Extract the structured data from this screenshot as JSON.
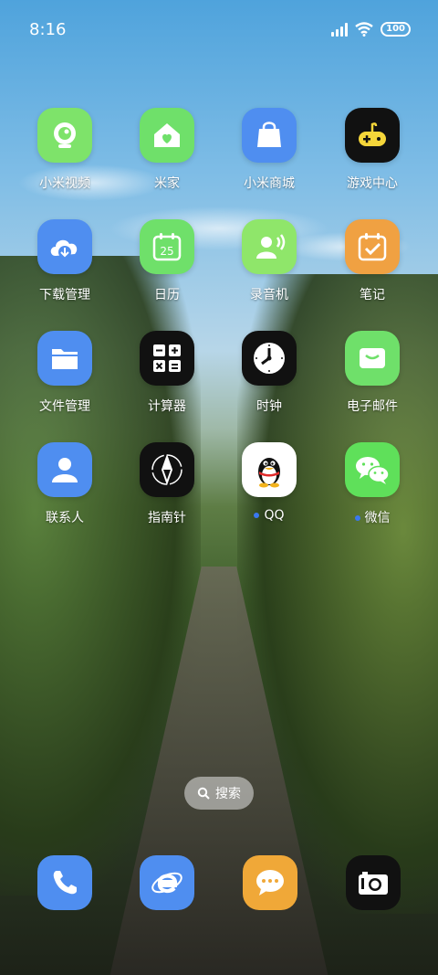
{
  "status_bar": {
    "time": "8:16",
    "battery": "100"
  },
  "apps": [
    {
      "label": "小米视频",
      "icon": "video-icon",
      "color": "#7ee36a"
    },
    {
      "label": "米家",
      "icon": "home-icon",
      "color": "#6fe06a"
    },
    {
      "label": "小米商城",
      "icon": "shopping-bag-icon",
      "color": "#4f8ef0"
    },
    {
      "label": "游戏中心",
      "icon": "game-controller-icon",
      "color": "#111111"
    },
    {
      "label": "下载管理",
      "icon": "download-cloud-icon",
      "color": "#4f8ef0"
    },
    {
      "label": "日历",
      "icon": "calendar-icon",
      "color": "#6fe06a",
      "badge": "25"
    },
    {
      "label": "录音机",
      "icon": "voice-recorder-icon",
      "color": "#8fe66a"
    },
    {
      "label": "笔记",
      "icon": "notes-icon",
      "color": "#f0a142"
    },
    {
      "label": "文件管理",
      "icon": "folder-icon",
      "color": "#4f8ef0"
    },
    {
      "label": "计算器",
      "icon": "calculator-icon",
      "color": "#111111"
    },
    {
      "label": "时钟",
      "icon": "clock-icon",
      "color": "#111111"
    },
    {
      "label": "电子邮件",
      "icon": "mail-icon",
      "color": "#6fe06a"
    },
    {
      "label": "联系人",
      "icon": "contacts-icon",
      "color": "#4f8ef0"
    },
    {
      "label": "指南针",
      "icon": "compass-icon",
      "color": "#111111"
    },
    {
      "label": "QQ",
      "icon": "qq-penguin-icon",
      "color": "#ffffff",
      "dot": true
    },
    {
      "label": "微信",
      "icon": "wechat-icon",
      "color": "#5fe05a",
      "dot": true
    }
  ],
  "search": {
    "label": "搜索"
  },
  "dock": [
    {
      "icon": "phone-icon",
      "color": "#4f8ef0"
    },
    {
      "icon": "browser-icon",
      "color": "#4f8ef0"
    },
    {
      "icon": "messages-icon",
      "color": "#f0a838"
    },
    {
      "icon": "camera-icon",
      "color": "#111111"
    }
  ]
}
